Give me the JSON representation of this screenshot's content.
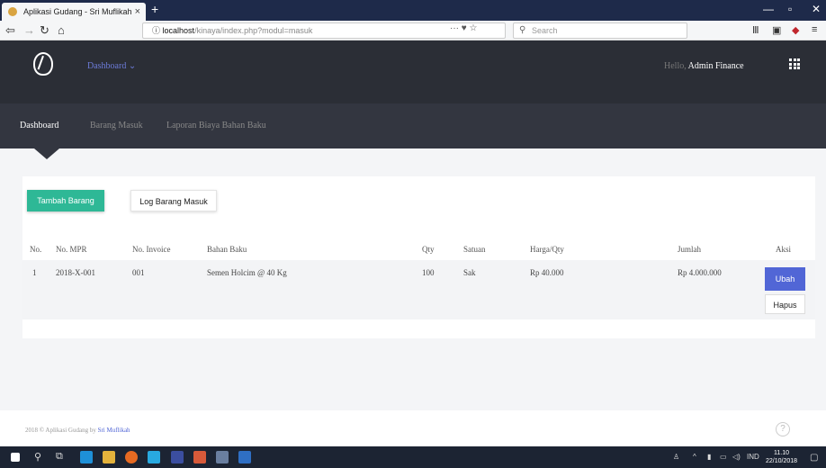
{
  "browser": {
    "tab_title": "Aplikasi Gudang - Sri Muflikah",
    "tab_close": "×",
    "new_tab": "+",
    "url_prefix": "ⓘ",
    "url_host": "localhost",
    "url_path": "/kinaya/index.php?modul=masuk",
    "page_actions": "··· ♥ ☆",
    "search_placeholder": "Search"
  },
  "header": {
    "dashboard_dropdown": "Dashboard  ⌄",
    "hello_prefix": "Hello, ",
    "user_name": "Admin Finance"
  },
  "nav": {
    "items": [
      {
        "label": "Dashboard",
        "active": true
      },
      {
        "label": "Barang Masuk",
        "active": false
      },
      {
        "label": "Laporan Biaya Bahan Baku",
        "active": false
      }
    ]
  },
  "actions": {
    "add_label": "Tambah Barang",
    "log_label": "Log Barang Masuk"
  },
  "table": {
    "columns": [
      "No.",
      "No. MPR",
      "No. Invoice",
      "Bahan Baku",
      "Qty",
      "Satuan",
      "Harga/Qty",
      "Jumlah",
      "Aksi"
    ],
    "rows": [
      {
        "no": "1",
        "mpr": "2018-X-001",
        "invoice": "001",
        "bahan": "Semen Holcim @ 40 Kg",
        "qty": "100",
        "satuan": "Sak",
        "harga": "Rp 40.000",
        "jumlah": "Rp 4.000.000",
        "edit_label": "Ubah",
        "delete_label": "Hapus"
      }
    ]
  },
  "footer": {
    "text": "2018 © Aplikasi Gudang by ",
    "author": "Sri Muflikah",
    "help": "?"
  },
  "taskbar": {
    "lang": "IND",
    "time": "11.10",
    "date": "22/10/2018"
  },
  "colors": {
    "primary": "#5166d6",
    "success": "#2eb896",
    "header_bg": "#2b2e36",
    "subnav_bg": "#333640"
  }
}
